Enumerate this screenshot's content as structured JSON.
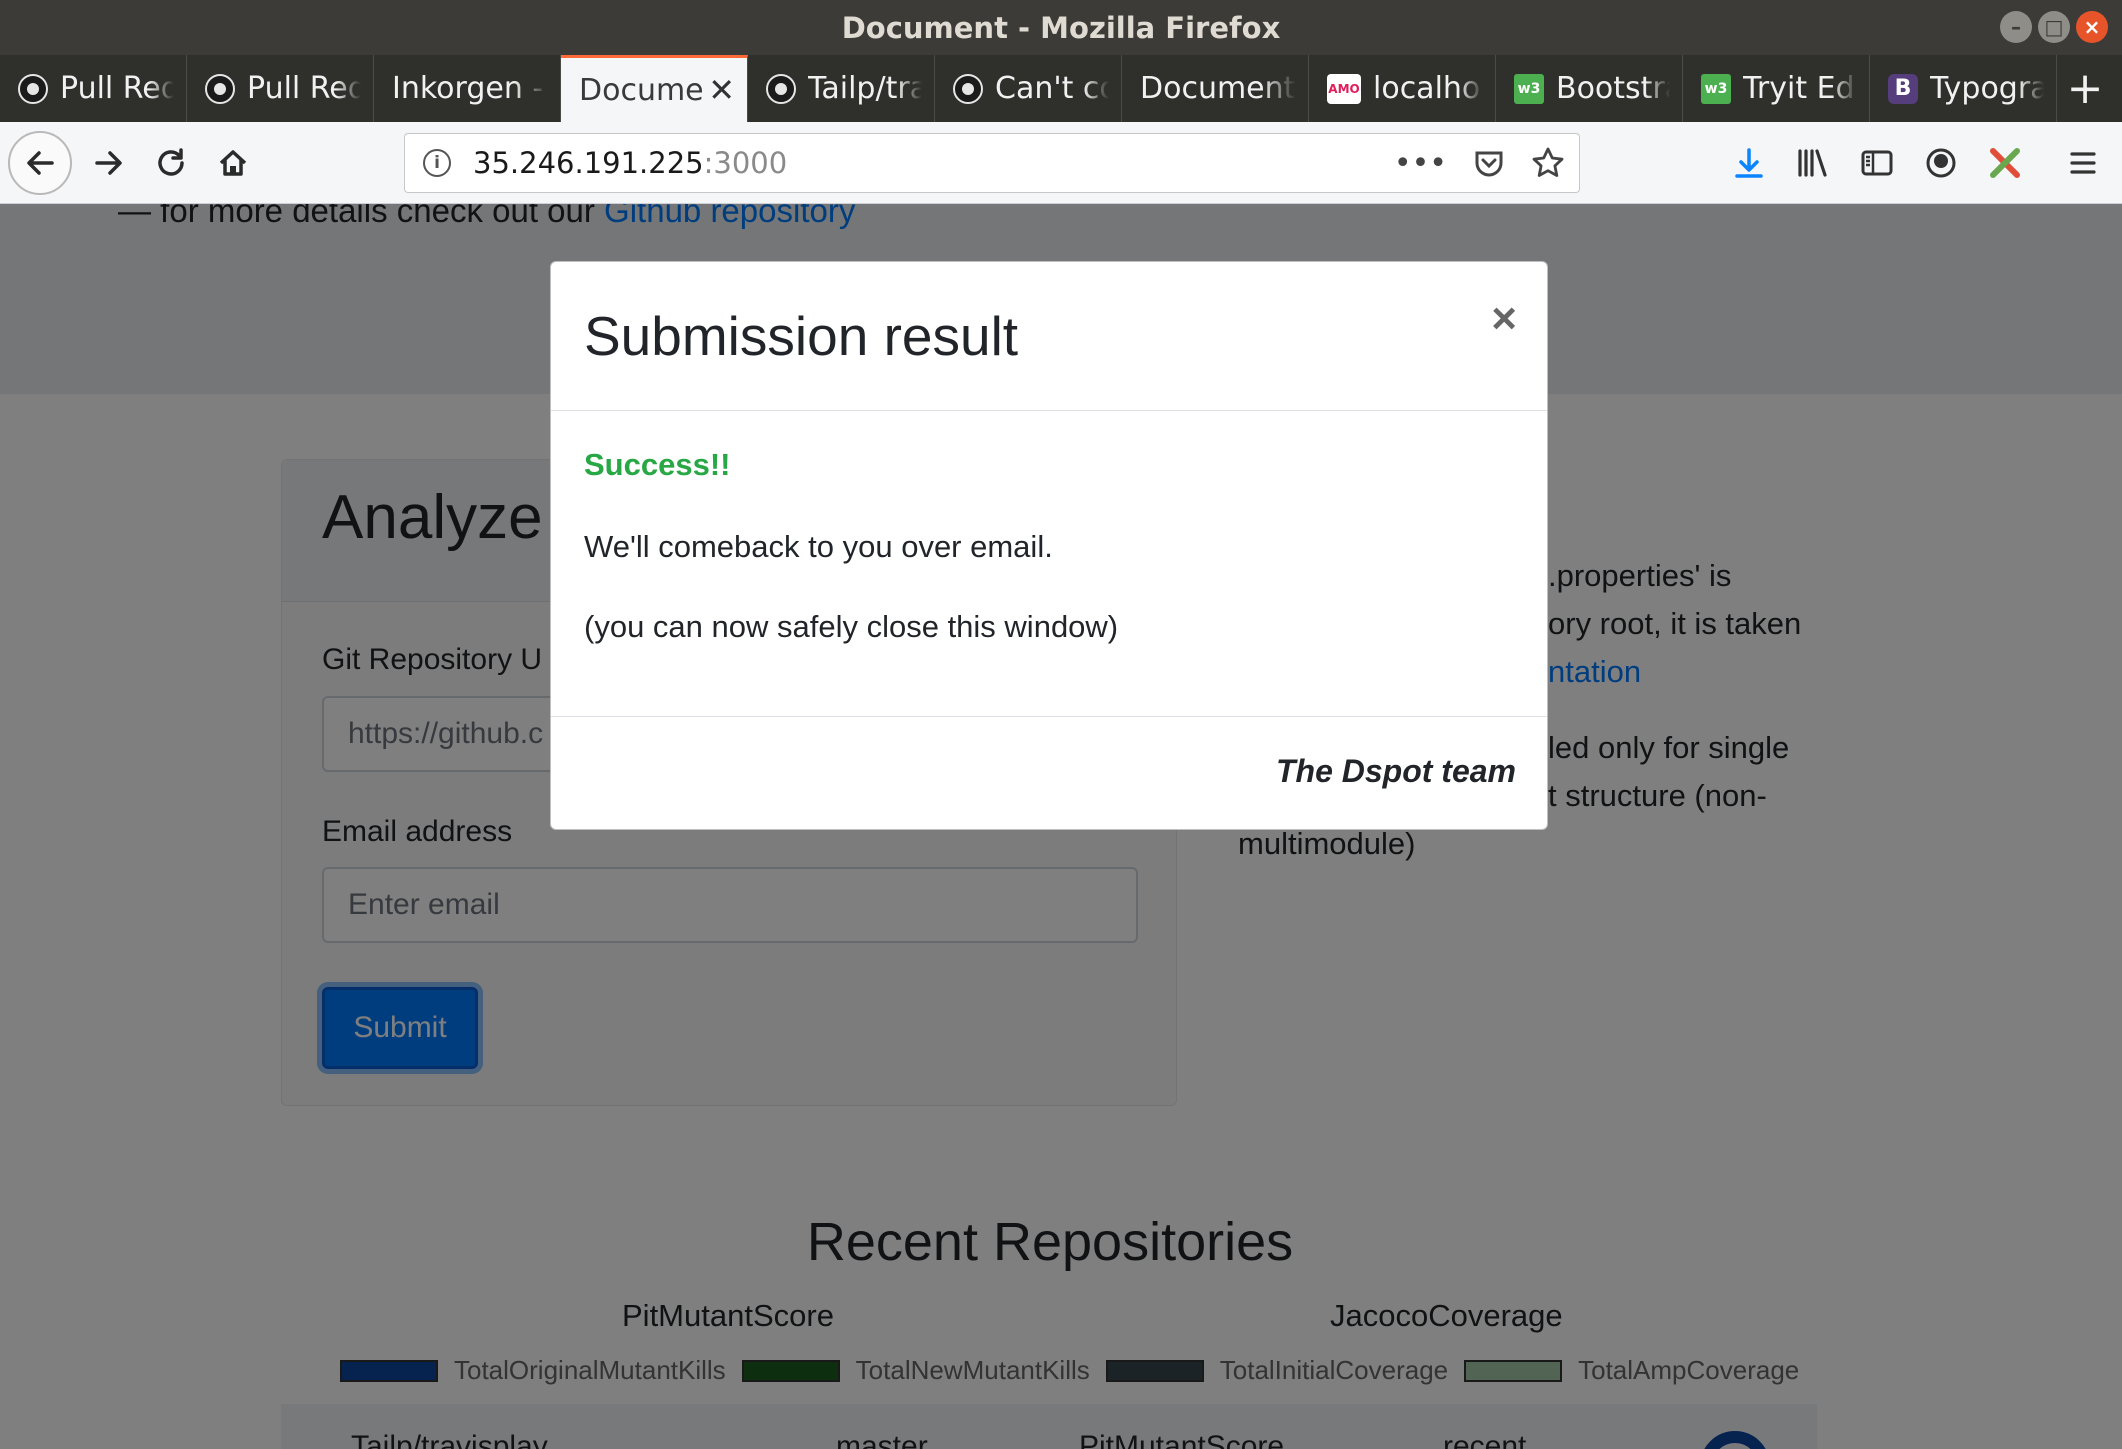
{
  "window": {
    "title": "Document - Mozilla Firefox"
  },
  "tabs": [
    {
      "label": "Pull Requests",
      "icon": "github-icon",
      "active": false
    },
    {
      "label": "Pull Requests",
      "icon": "github-icon",
      "active": false
    },
    {
      "label": "Inkorgen - ",
      "icon": "",
      "active": false
    },
    {
      "label": "Document",
      "icon": "",
      "active": true
    },
    {
      "label": "Tailp/travis",
      "icon": "github-icon",
      "active": false
    },
    {
      "label": "Can't comp",
      "icon": "github-icon",
      "active": false
    },
    {
      "label": "Document",
      "icon": "",
      "active": false
    },
    {
      "label": "localhost",
      "icon": "amo-icon",
      "active": false
    },
    {
      "label": "Bootstrap",
      "icon": "w3schools-icon",
      "active": false
    },
    {
      "label": "Tryit Editor",
      "icon": "w3schools-icon",
      "active": false
    },
    {
      "label": "Typography",
      "icon": "bootstrap-icon",
      "active": false
    }
  ],
  "address": {
    "host": "35.246.191.225",
    "port": ":3000"
  },
  "page": {
    "jumbotron": {
      "prefix": "— for more details check out our ",
      "link": "Github repository"
    },
    "form": {
      "card_title": "Analyze",
      "repo_label": "Git Repository U",
      "repo_placeholder": "https://github.c",
      "email_label": "Email address",
      "email_placeholder": "Enter email",
      "submit_label": "Submit"
    },
    "notes": {
      "line1": ".properties' is",
      "line2": "ory root, it is taken",
      "link": "ntation",
      "line3": "led only for single",
      "line4": "t structure (non-",
      "line5": "multimodule)"
    },
    "recent": {
      "title": "Recent Repositories",
      "chart1_title": "PitMutantScore",
      "chart2_title": "JacocoCoverage",
      "legend": [
        {
          "label": "TotalOriginalMutantKills",
          "color": "#0d47a1"
        },
        {
          "label": "TotalNewMutantKills",
          "color": "#1b5e20"
        },
        {
          "label": "TotalInitialCoverage",
          "color": "#37474f"
        },
        {
          "label": "TotalAmpCoverage",
          "color": "#a5c8a9"
        }
      ],
      "row": {
        "repo": "Tailp/travisplay",
        "branch": "master",
        "metric": "PitMutantScore",
        "tag": "recent"
      }
    }
  },
  "modal": {
    "title": "Submission result",
    "close_glyph": "×",
    "success": "Success!!",
    "line1": "We'll comeback to you over email.",
    "line2": "(you can now safely close this window)",
    "signature": "The Dspot team"
  }
}
